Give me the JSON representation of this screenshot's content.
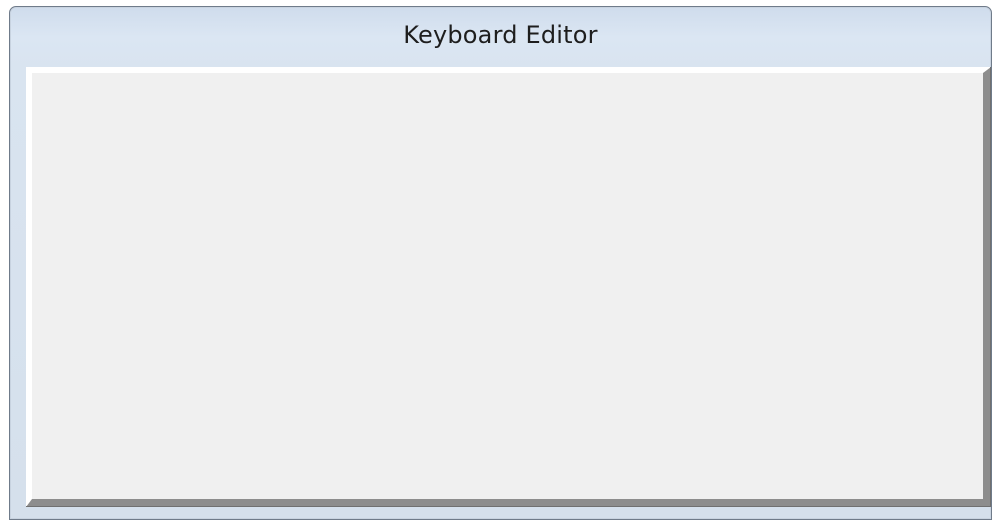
{
  "window": {
    "title": "Keyboard Editor"
  }
}
